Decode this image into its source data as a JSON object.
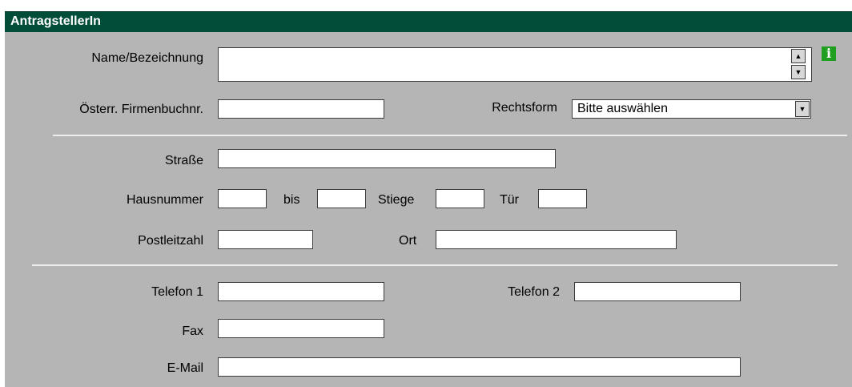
{
  "section": {
    "title": "AntragstellerIn"
  },
  "fields": {
    "name": {
      "label": "Name/Bezeichnung",
      "value": ""
    },
    "firmenbuchnr": {
      "label": "Österr. Firmenbuchnr.",
      "value": ""
    },
    "rechtsform": {
      "label": "Rechtsform",
      "selected": "Bitte auswählen"
    },
    "strasse": {
      "label": "Straße",
      "value": ""
    },
    "hausnummer": {
      "label": "Hausnummer",
      "value": ""
    },
    "bis": {
      "label": "bis",
      "value": ""
    },
    "stiege": {
      "label": "Stiege",
      "value": ""
    },
    "tuer": {
      "label": "Tür",
      "value": ""
    },
    "plz": {
      "label": "Postleitzahl",
      "value": ""
    },
    "ort": {
      "label": "Ort",
      "value": ""
    },
    "telefon1": {
      "label": "Telefon 1",
      "value": ""
    },
    "telefon2": {
      "label": "Telefon 2",
      "value": ""
    },
    "fax": {
      "label": "Fax",
      "value": ""
    },
    "email": {
      "label": "E-Mail",
      "value": ""
    }
  },
  "icons": {
    "info": "info-icon",
    "spin_up": "▲",
    "spin_down": "▼",
    "dropdown": "▼"
  },
  "colors": {
    "header_bg": "#014d3a",
    "panel_bg": "#b5b5b5",
    "info_green": "#1f9e1f"
  }
}
